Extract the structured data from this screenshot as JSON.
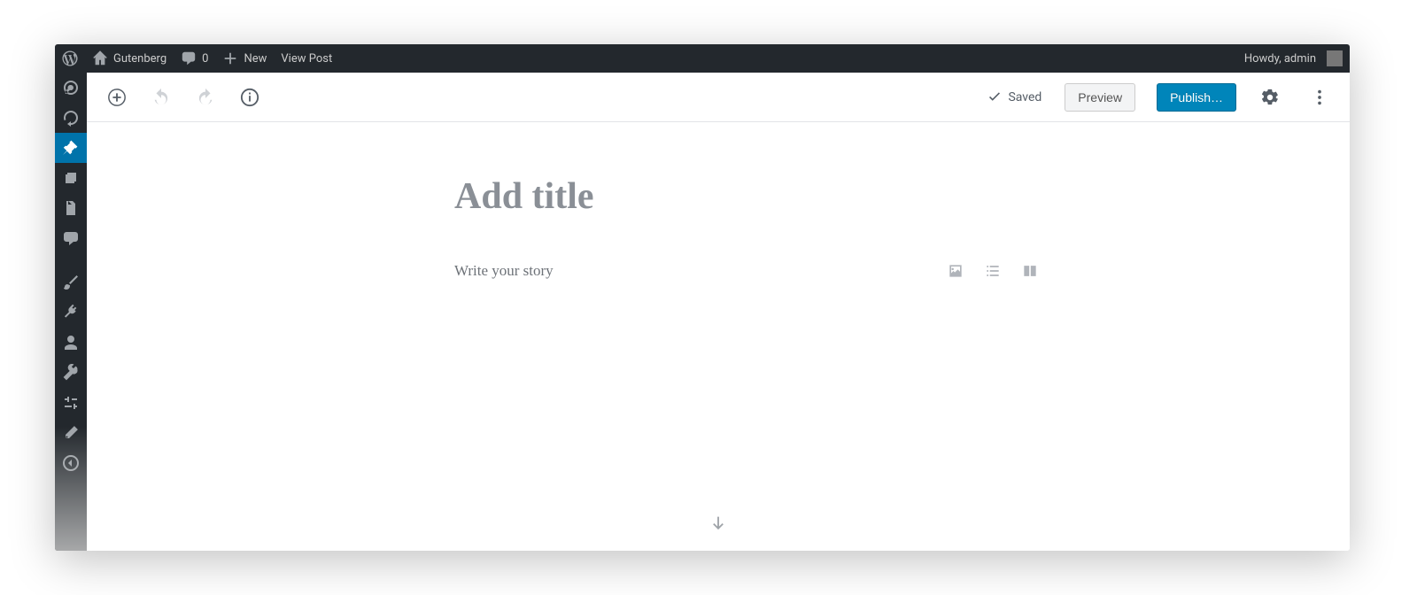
{
  "adminbar": {
    "site_name": "Gutenberg",
    "comment_count": "0",
    "new_label": "New",
    "view_post": "View Post",
    "howdy": "Howdy, admin"
  },
  "sidebar": {
    "items": [
      {
        "id": "dashboard",
        "active": false
      },
      {
        "id": "updates",
        "active": false
      },
      {
        "id": "posts",
        "active": true
      },
      {
        "id": "media",
        "active": false
      },
      {
        "id": "pages",
        "active": false
      },
      {
        "id": "comments",
        "active": false
      },
      {
        "id": "appearance",
        "active": false
      },
      {
        "id": "plugins",
        "active": false
      },
      {
        "id": "users",
        "active": false
      },
      {
        "id": "tools",
        "active": false
      },
      {
        "id": "settings",
        "active": false
      },
      {
        "id": "collapse",
        "active": false
      },
      {
        "id": "other",
        "active": false
      }
    ]
  },
  "toolbar": {
    "saved_label": "Saved",
    "preview_label": "Preview",
    "publish_label": "Publish…"
  },
  "editor": {
    "title_placeholder": "Add title",
    "story_placeholder": "Write your story"
  }
}
